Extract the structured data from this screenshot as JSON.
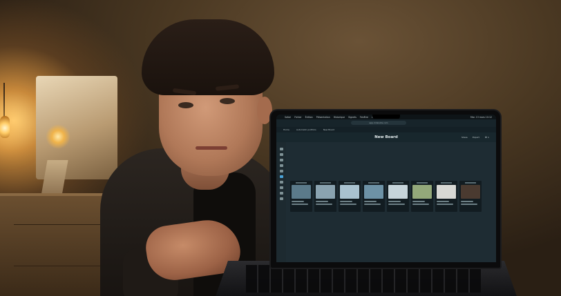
{
  "scene": {
    "description_elements": [
      "person",
      "laptop",
      "lamp",
      "monitor",
      "desk"
    ]
  },
  "screen": {
    "menubar_items": [
      "Safari",
      "Fichier",
      "Édition",
      "Présentation",
      "Historique",
      "Signets",
      "Fenêtre",
      "Aide"
    ],
    "clock": "Mar. 13 mars 10:12",
    "url": "app.milanote.com",
    "tabs": [
      "Home",
      "Automatic portfolio",
      "New Board"
    ],
    "board_title": "New Board",
    "share_label": "Share",
    "export_label": "Export",
    "zoom_label": "⌘ 1",
    "card_thumb_colors": [
      "#5b7a8a",
      "#8aa3b0",
      "#a9c2cf",
      "#6d92a6",
      "#c6d4da",
      "#93a87a",
      "#d8d8d4",
      "#4a3a30"
    ]
  },
  "colors": {
    "screen_bg": "#1d2a30",
    "accent": "#4aa3d8",
    "lamp_glow": "#ffcc66"
  }
}
